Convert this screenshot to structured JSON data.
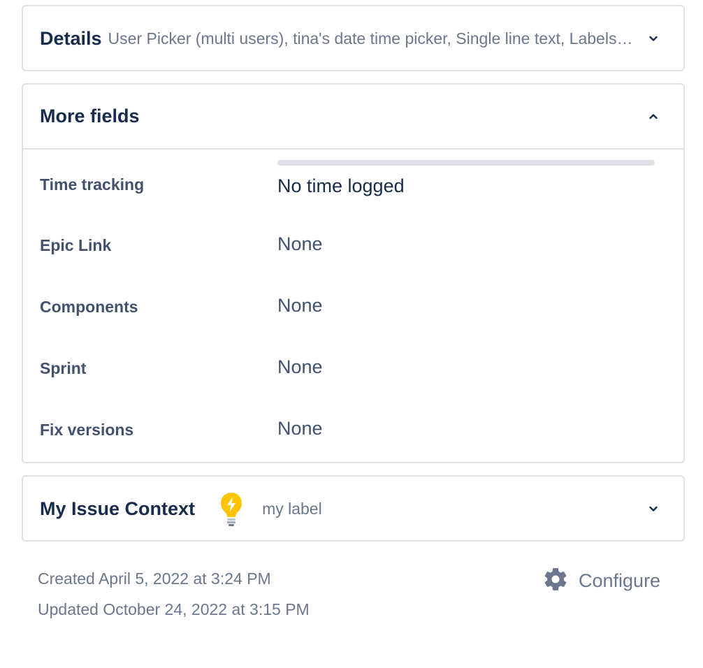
{
  "details_panel": {
    "title": "Details",
    "summary": "User Picker (multi users), tina's date time picker, Single line text, Labels, Priority",
    "expanded": false
  },
  "more_fields_panel": {
    "title": "More fields",
    "expanded": true,
    "time_tracking": {
      "label": "Time tracking",
      "value": "No time logged",
      "progress": 0
    },
    "fields": [
      {
        "label": "Epic Link",
        "value": "None"
      },
      {
        "label": "Components",
        "value": "None"
      },
      {
        "label": "Sprint",
        "value": "None"
      },
      {
        "label": "Fix versions",
        "value": "None"
      }
    ]
  },
  "issue_context_panel": {
    "title": "My Issue Context",
    "icon": "lightbulb-icon",
    "label": "my label",
    "expanded": false
  },
  "footer": {
    "created": "Created April 5, 2022 at 3:24 PM",
    "updated": "Updated October 24, 2022 at 3:15 PM",
    "configure_label": "Configure",
    "configure_icon": "gear-icon"
  },
  "colors": {
    "heading": "#172B4D",
    "secondary_text": "#6B778C",
    "label_text": "#42526E",
    "border": "#DFE1E6",
    "bulb": "#FFC400"
  }
}
